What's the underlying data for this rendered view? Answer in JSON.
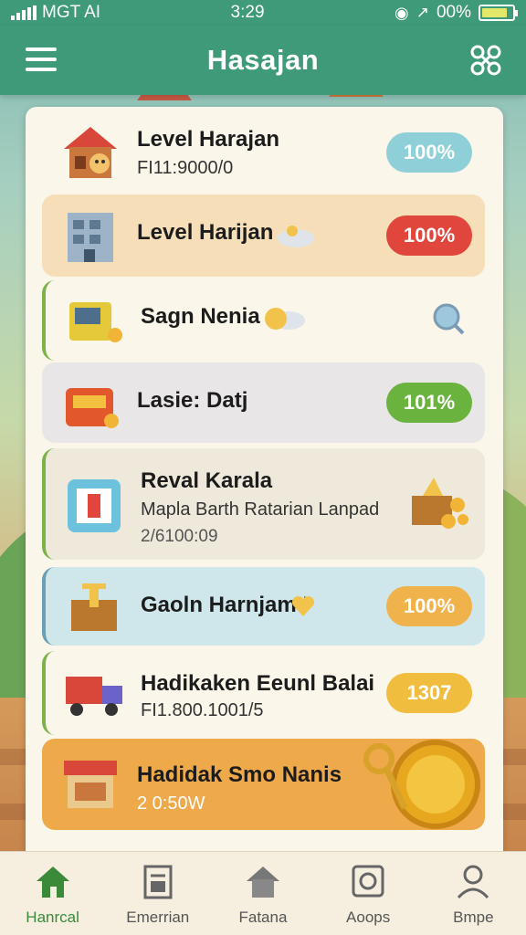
{
  "status": {
    "carrier": "MGT AI",
    "time": "3:29",
    "battery": "00%",
    "battery_level": 0.85
  },
  "app": {
    "title": "Hasajan"
  },
  "items": [
    {
      "title": "Level Harajan",
      "subtitle": "FI11:9000/0",
      "badge": "100%",
      "badge_color": "#8fd0d8",
      "icon": "house-icon"
    },
    {
      "title": "Level Harijan",
      "badge": "100%",
      "badge_color": "#e0463b",
      "icon": "building-icon"
    },
    {
      "title": "Sagn Nenia",
      "icon": "atm-machine-icon"
    },
    {
      "title": "Lasie: Datj",
      "badge": "101%",
      "badge_color": "#6ab33f",
      "icon": "cash-register-icon"
    },
    {
      "title": "Reval Karala",
      "subtitle": "Mapla Barth Ratarian Lanpad",
      "detail": "2/6100:09",
      "icon": "gift-box-icon"
    },
    {
      "title": "Gaoln Harnjam I",
      "badge": "100%",
      "badge_color": "#f0b24a",
      "icon": "treasure-box-icon"
    },
    {
      "title": "Hadikaken Eeunl Balai",
      "subtitle": "FI1.800.1001/5",
      "badge": "1307",
      "badge_color": "#f1bd3f",
      "icon": "delivery-truck-icon"
    },
    {
      "title": "Hadidak Smo Nanis",
      "subtitle": "2 0:50W",
      "icon": "shop-stall-icon"
    }
  ],
  "nav": [
    {
      "label": "Hanrcal",
      "icon": "home-icon"
    },
    {
      "label": "Emerrian",
      "icon": "document-icon"
    },
    {
      "label": "Fatana",
      "icon": "house-outline-icon"
    },
    {
      "label": "Aoops",
      "icon": "safe-icon"
    },
    {
      "label": "Bmpe",
      "icon": "profile-icon"
    }
  ]
}
